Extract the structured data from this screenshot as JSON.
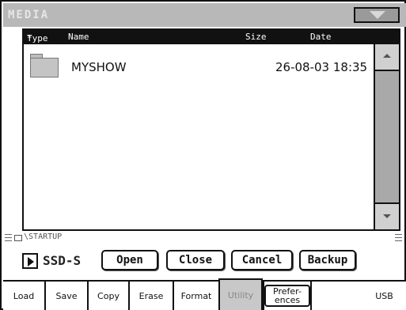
{
  "window": {
    "title": "MEDIA"
  },
  "columns": {
    "type": "Type",
    "sort_marker": "*",
    "name": "Name",
    "size": "Size",
    "date": "Date"
  },
  "files": [
    {
      "name": "MYSHOW",
      "date": "26-08-03 18:35",
      "icon": "folder-icon"
    }
  ],
  "path": {
    "text": "STARTUP",
    "drive_icon": "drive-icon"
  },
  "device": {
    "label": "SSD-S"
  },
  "buttons": {
    "open": "Open",
    "close": "Close",
    "cancel": "Cancel",
    "backup": "Backup"
  },
  "tabs": [
    {
      "label": "Load"
    },
    {
      "label": "Save"
    },
    {
      "label": "Copy"
    },
    {
      "label": "Erase"
    },
    {
      "label": "Format"
    },
    {
      "label": "Utility",
      "active": true
    },
    {
      "label": "Prefer- ences"
    },
    {
      "label": "USB"
    }
  ]
}
